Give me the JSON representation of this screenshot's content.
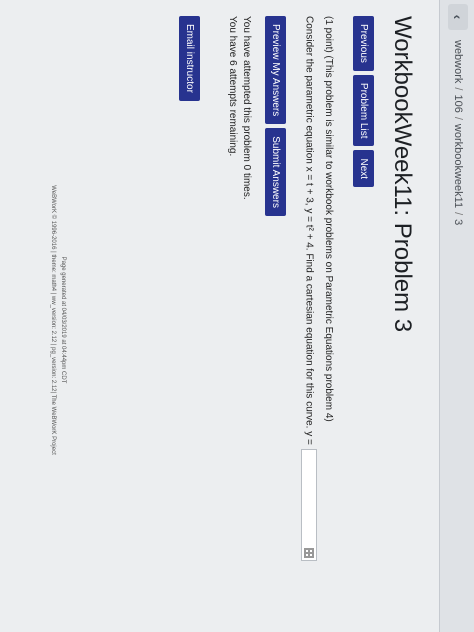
{
  "breadcrumb": {
    "items": [
      "webwork",
      "106",
      "workbookweek11",
      "3"
    ]
  },
  "page_title": "WorkbookWeek11: Problem 3",
  "nav": {
    "previous": "Previous",
    "problem_list": "Problem List",
    "next": "Next"
  },
  "problem": {
    "intro": "(1 point) (This problem is similar to workbook problems on Parametric Equations problem 4)",
    "question": "Consider the parametric equation x = t + 3, y = t² + 4. Find a cartesian equation for this curve. y ="
  },
  "actions": {
    "preview": "Preview My Answers",
    "submit": "Submit Answers"
  },
  "status": {
    "attempted": "You have attempted this problem 0 times.",
    "remaining": "You have 6 attempts remaining."
  },
  "email_instructor": "Email instructor",
  "footer": {
    "generated": "Page generated at 04/03/2019 at 04:44pm CDT",
    "copyright": "WeBWorK © 1996-2016 | theme: math4 | ww_version: 2.12 | pg_version: 2.12| The WeBWorK Project"
  }
}
